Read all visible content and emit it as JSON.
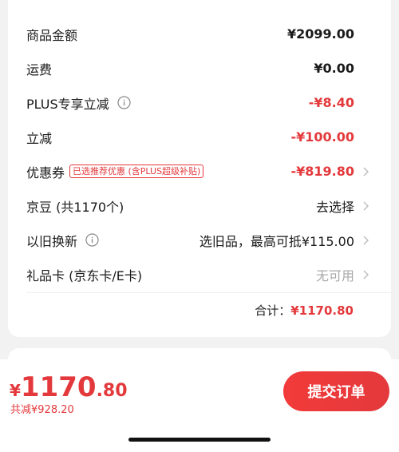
{
  "summary": {
    "rows": [
      {
        "label": "商品金额",
        "value": "¥2099.00"
      },
      {
        "label": "运费",
        "value": "¥0.00"
      },
      {
        "label": "PLUS专享立减",
        "value": "-¥8.40"
      },
      {
        "label": "立减",
        "value": "-¥100.00"
      },
      {
        "label": "优惠券",
        "tag": "已选推荐优惠 (含PLUS超级补贴)",
        "value": "-¥819.80"
      },
      {
        "label": "京豆 (共1170个)",
        "value": "去选择"
      },
      {
        "label": "以旧换新",
        "value": "选旧品，最高可抵¥115.00"
      },
      {
        "label": "礼品卡 (京东卡/E卡)",
        "value": "无可用"
      }
    ],
    "total_label": "合计：",
    "total_value": "¥1170.80"
  },
  "footer": {
    "currency": "¥",
    "price_int": "1170",
    "price_dec": ".80",
    "saved_text": "共减¥928.20",
    "submit_label": "提交订单"
  },
  "colors": {
    "accent": "#e4393c",
    "muted": "#a8a8a8"
  }
}
